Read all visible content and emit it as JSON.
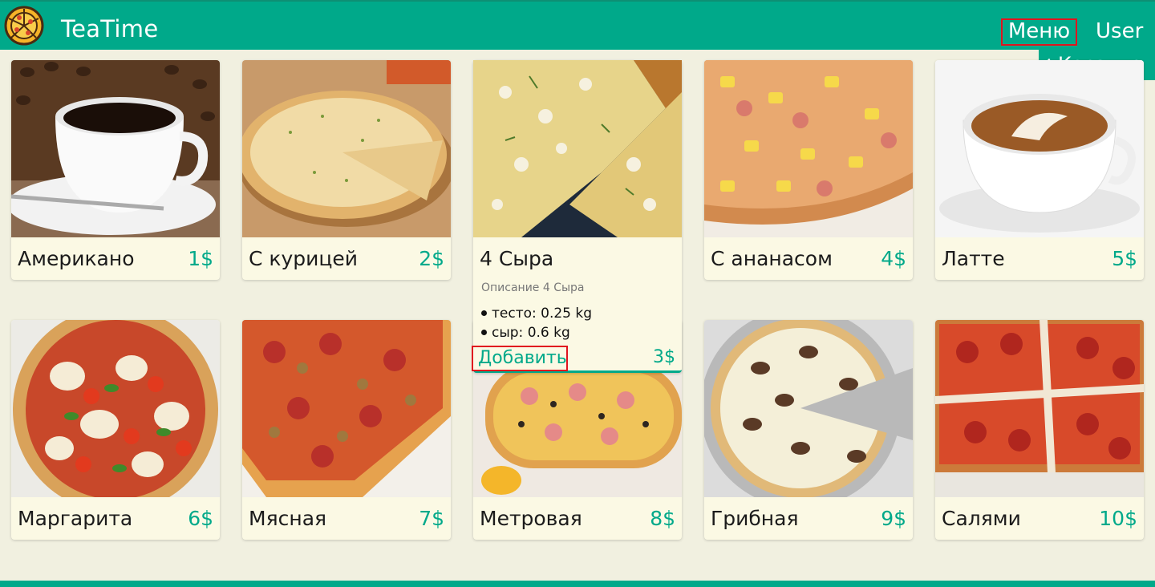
{
  "header": {
    "brand": "TeaTime",
    "menu_label": "Меню",
    "user_label": "User",
    "cart_label": "Корзина"
  },
  "products": [
    {
      "name": "Американо",
      "price": "1$",
      "image": "coffee-cup-image"
    },
    {
      "name": "С курицей",
      "price": "2$",
      "image": "chicken-pizza-image"
    },
    {
      "name": "4 Сыра",
      "price": "3$",
      "image": "four-cheese-pizza-image",
      "description": "Описание 4 Сыра",
      "ingredients": [
        "тесто: 0.25 kg",
        "сыр: 0.6 kg"
      ],
      "add_label": "Добавить"
    },
    {
      "name": "С ананасом",
      "price": "4$",
      "image": "pineapple-pizza-image"
    },
    {
      "name": "Латте",
      "price": "5$",
      "image": "latte-image"
    },
    {
      "name": "Маргарита",
      "price": "6$",
      "image": "margherita-pizza-image"
    },
    {
      "name": "Мясная",
      "price": "7$",
      "image": "meat-pizza-image"
    },
    {
      "name": "Метровая",
      "price": "8$",
      "image": "meter-pizza-image"
    },
    {
      "name": "Грибная",
      "price": "9$",
      "image": "mushroom-pizza-image"
    },
    {
      "name": "Салями",
      "price": "10$",
      "image": "salami-pizza-image"
    }
  ],
  "colors": {
    "accent": "#00a98a",
    "background": "#f1f0e0",
    "card": "#fbf9e4",
    "highlight": "#e0141e"
  }
}
